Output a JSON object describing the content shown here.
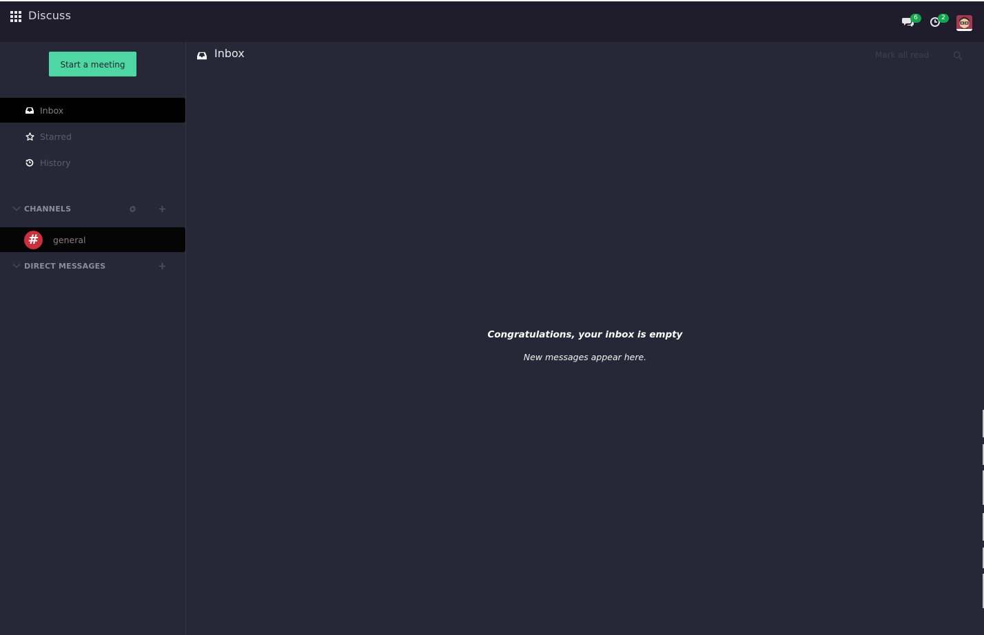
{
  "topbar": {
    "app_title": "Discuss",
    "app_menu_icon": "grid-apps-icon",
    "messages_count": "6",
    "activities_count": "2",
    "messages_icon": "chat-bubbles-icon",
    "activities_icon": "clock-icon",
    "avatar_icon": "user-avatar"
  },
  "sidebar": {
    "start_meeting_label": "Start a meeting",
    "items": [
      {
        "label": "Inbox",
        "icon": "inbox-icon",
        "active": true
      },
      {
        "label": "Starred",
        "icon": "star-icon",
        "active": false
      },
      {
        "label": "History",
        "icon": "history-icon",
        "active": false
      }
    ],
    "channels_header": "CHANNELS",
    "channels": [
      {
        "name": "general",
        "avatar": "#",
        "avatar_color": "#c8303c"
      }
    ],
    "dm_header": "DIRECT MESSAGES"
  },
  "main": {
    "title": "Inbox",
    "mark_all_read_label": "Mark all read",
    "empty_title": "Congratulations, your inbox is empty",
    "empty_subtitle": "New messages appear here."
  },
  "colors": {
    "topbar_bg": "#1f1d2b",
    "page_bg": "#262837",
    "accent_button": "#4ed7a5",
    "badge": "#17a650",
    "active_item_bg": "#000000"
  }
}
